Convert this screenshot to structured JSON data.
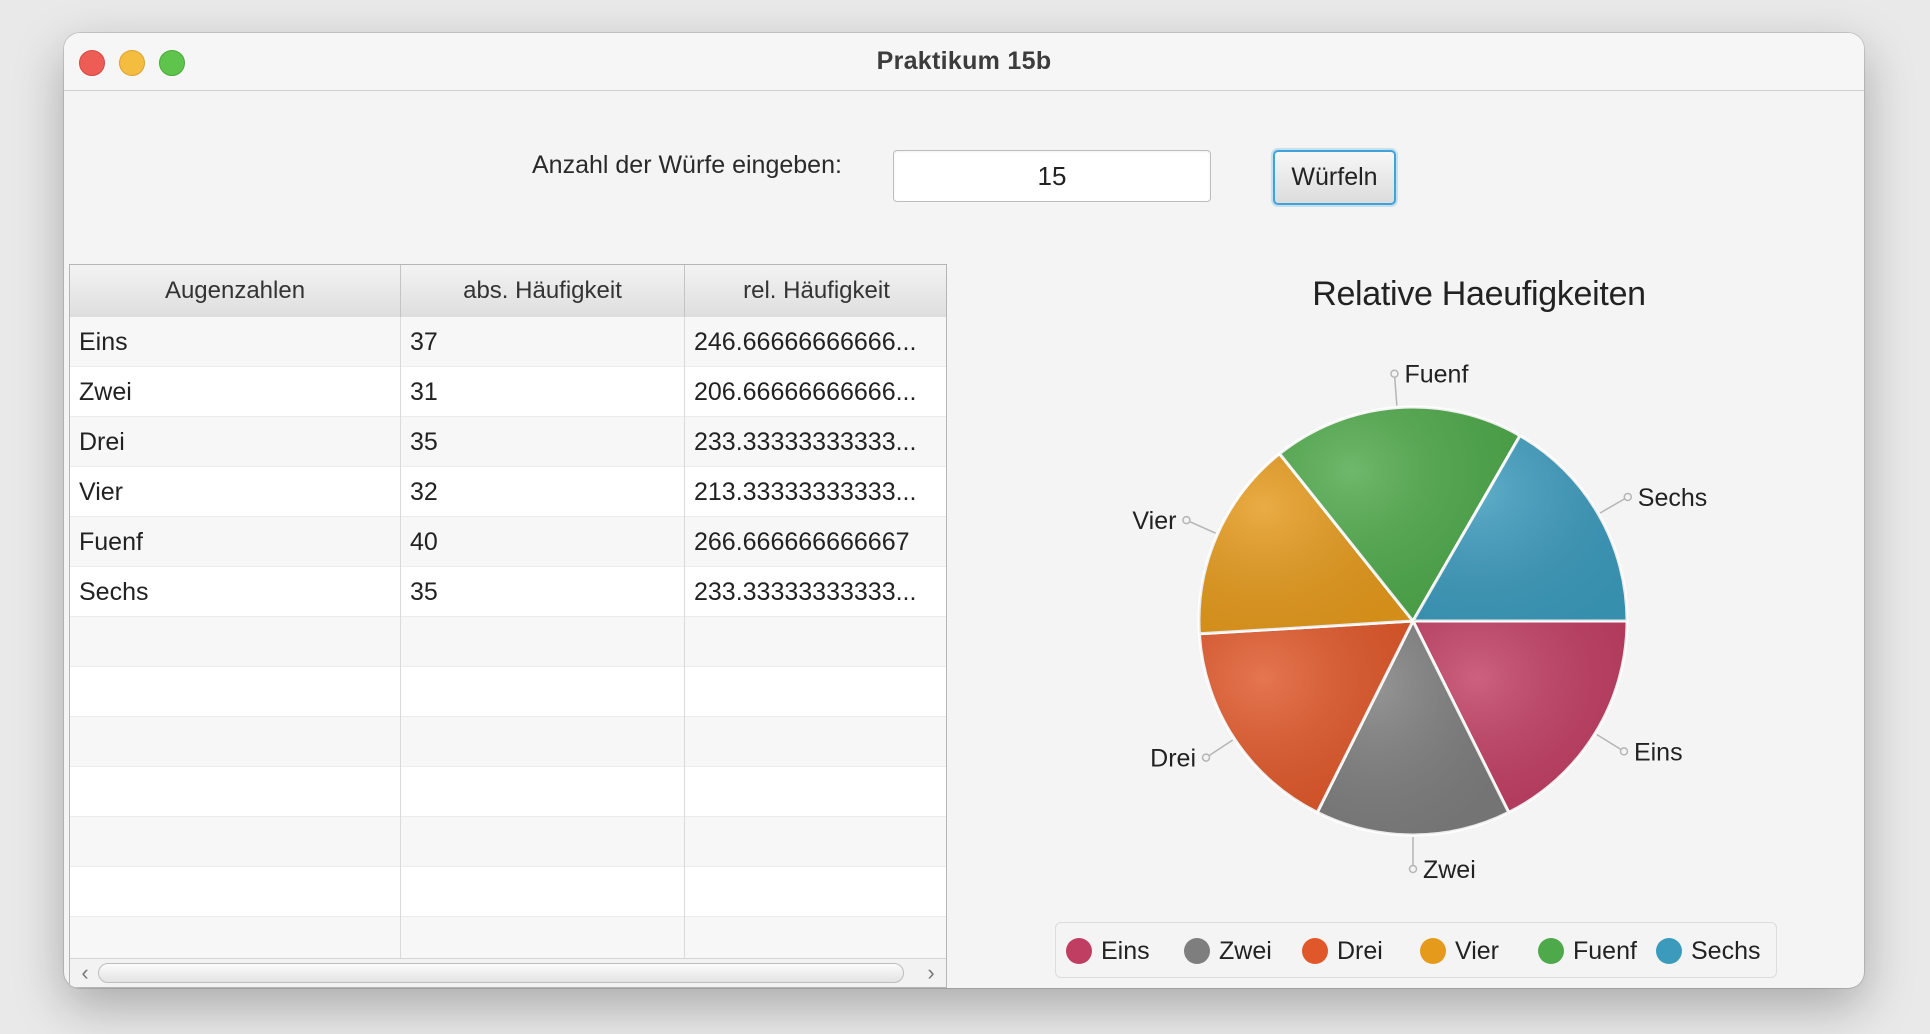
{
  "window": {
    "title": "Praktikum 15b"
  },
  "form": {
    "prompt": "Anzahl der Würfe eingeben:",
    "count_value": "15",
    "roll_button": "Würfeln"
  },
  "table": {
    "headers": [
      "Augenzahlen",
      "abs. Häufigkeit",
      "rel. Häufigkeit"
    ],
    "rows": [
      {
        "face": "Eins",
        "abs": "37",
        "rel": "246.66666666666..."
      },
      {
        "face": "Zwei",
        "abs": "31",
        "rel": "206.66666666666..."
      },
      {
        "face": "Drei",
        "abs": "35",
        "rel": "233.33333333333..."
      },
      {
        "face": "Vier",
        "abs": "32",
        "rel": "213.33333333333..."
      },
      {
        "face": "Fuenf",
        "abs": "40",
        "rel": "266.666666666667"
      },
      {
        "face": "Sechs",
        "abs": "35",
        "rel": "233.33333333333..."
      }
    ],
    "scroll_left_icon": "‹",
    "scroll_right_icon": "›"
  },
  "chart_data": {
    "type": "pie",
    "title": "Relative Haeufigkeiten",
    "slices": [
      {
        "name": "Eins",
        "value": 246.67,
        "color": "#c13e63"
      },
      {
        "name": "Zwei",
        "value": 206.67,
        "color": "#7e7e7e"
      },
      {
        "name": "Drei",
        "value": 233.33,
        "color": "#e0582a"
      },
      {
        "name": "Vier",
        "value": 213.33,
        "color": "#e59a1c"
      },
      {
        "name": "Fuenf",
        "value": 266.67,
        "color": "#4ea94a"
      },
      {
        "name": "Sechs",
        "value": 233.33,
        "color": "#3c9bbd"
      }
    ],
    "legend_position": "bottom"
  }
}
